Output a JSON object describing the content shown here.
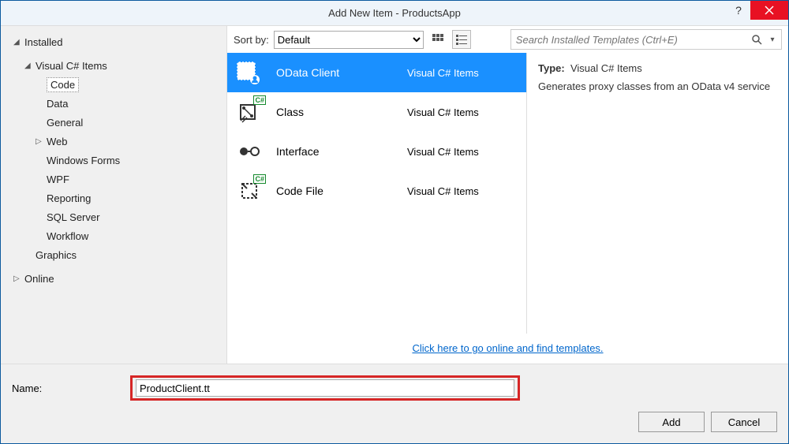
{
  "title": "Add New Item - ProductsApp",
  "sidebar": {
    "installed": "Installed",
    "csharp": "Visual C# Items",
    "items": [
      {
        "label": "Code"
      },
      {
        "label": "Data"
      },
      {
        "label": "General"
      },
      {
        "label": "Web"
      },
      {
        "label": "Windows Forms"
      },
      {
        "label": "WPF"
      },
      {
        "label": "Reporting"
      },
      {
        "label": "SQL Server"
      },
      {
        "label": "Workflow"
      }
    ],
    "graphics": "Graphics",
    "online": "Online"
  },
  "toolbar": {
    "sort_label": "Sort by:",
    "sort_value": "Default",
    "search_placeholder": "Search Installed Templates (Ctrl+E)"
  },
  "templates": [
    {
      "name": "OData Client",
      "lang": "Visual C# Items"
    },
    {
      "name": "Class",
      "lang": "Visual C# Items"
    },
    {
      "name": "Interface",
      "lang": "Visual C# Items"
    },
    {
      "name": "Code File",
      "lang": "Visual C# Items"
    }
  ],
  "info": {
    "type_label": "Type:",
    "type_value": "Visual C# Items",
    "description": "Generates proxy classes from an OData v4 service"
  },
  "link_text": "Click here to go online and find templates.",
  "name_label": "Name:",
  "name_value": "ProductClient.tt",
  "buttons": {
    "add": "Add",
    "cancel": "Cancel"
  }
}
